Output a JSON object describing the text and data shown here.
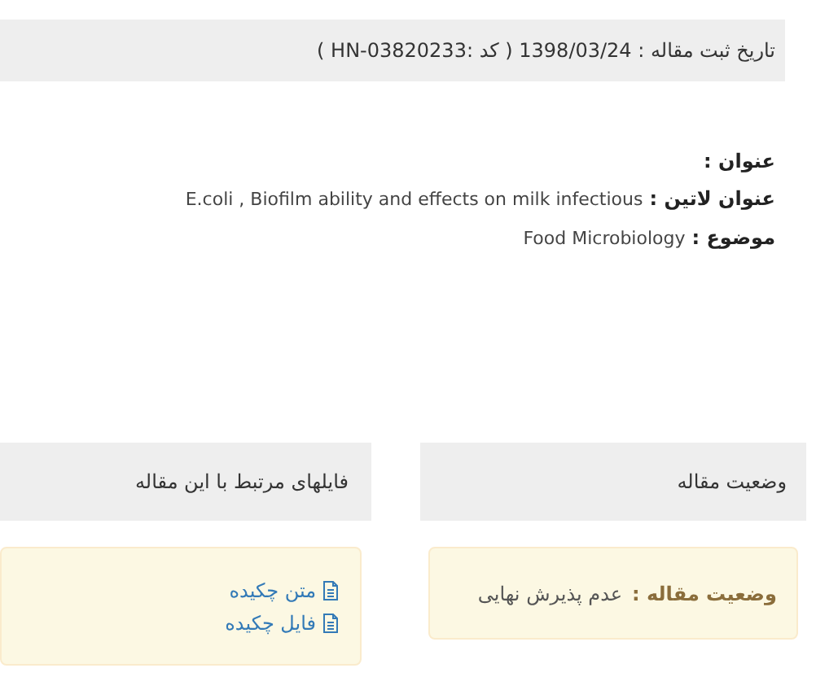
{
  "header": {
    "text": "تاریخ ثبت مقاله : 1398/03/24 ( کد :HN-03820233 )"
  },
  "fields": [
    {
      "label": "عنوان :"
    },
    {
      "label": "عنوان لاتین :",
      "value": "E.coli , Biofilm ability and effects on milk infectious"
    },
    {
      "label": "موضوع :",
      "value": "Food Microbiology"
    }
  ],
  "status_panel": {
    "title": "وضعیت مقاله",
    "label": "وضعیت مقاله :",
    "value": "عدم پذیرش نهایی"
  },
  "files_panel": {
    "title": "فایلهای مرتبط با این مقاله",
    "links": [
      "متن چکیده",
      "فایل چکیده"
    ]
  }
}
